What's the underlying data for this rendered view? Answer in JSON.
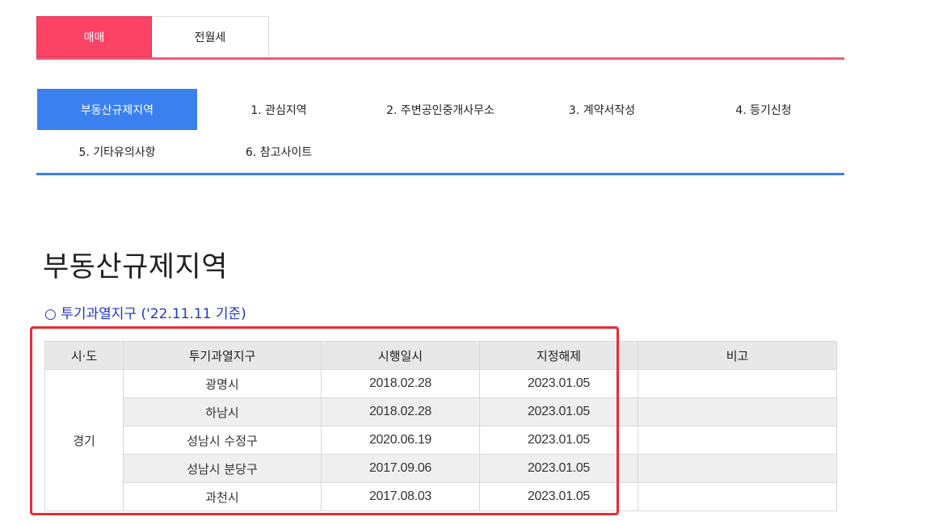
{
  "top_tabs": [
    {
      "label": "매매",
      "active": true
    },
    {
      "label": "전월세",
      "active": false
    }
  ],
  "sub_nav": [
    {
      "label": "부동산규제지역",
      "active": true
    },
    {
      "label": "1. 관심지역",
      "active": false
    },
    {
      "label": "2. 주변공인중개사무소",
      "active": false
    },
    {
      "label": "3. 계약서작성",
      "active": false
    },
    {
      "label": "4. 등기신청",
      "active": false
    },
    {
      "label": "5. 기타유의사항",
      "active": false
    },
    {
      "label": "6. 참고사이트",
      "active": false
    }
  ],
  "page_title": "부동산규제지역",
  "subtitle": "○ 투기과열지구 ('22.11.11 기준)",
  "table": {
    "headers": [
      "시·도",
      "투기과열지구",
      "시행일시",
      "지정해제",
      "비고"
    ],
    "region": "경기",
    "rows": [
      {
        "district": "광명시",
        "start": "2018.02.28",
        "release": "2023.01.05",
        "note": ""
      },
      {
        "district": "하남시",
        "start": "2018.02.28",
        "release": "2023.01.05",
        "note": ""
      },
      {
        "district": "성남시 수정구",
        "start": "2020.06.19",
        "release": "2023.01.05",
        "note": ""
      },
      {
        "district": "성남시 분당구",
        "start": "2017.09.06",
        "release": "2023.01.05",
        "note": ""
      },
      {
        "district": "과천시",
        "start": "2017.08.03",
        "release": "2023.01.05",
        "note": ""
      }
    ]
  },
  "colors": {
    "primary_tab": "#fc4265",
    "sub_nav_active": "#3a80ee",
    "subtitle": "#1f36c8",
    "highlight": "#e62c35"
  }
}
